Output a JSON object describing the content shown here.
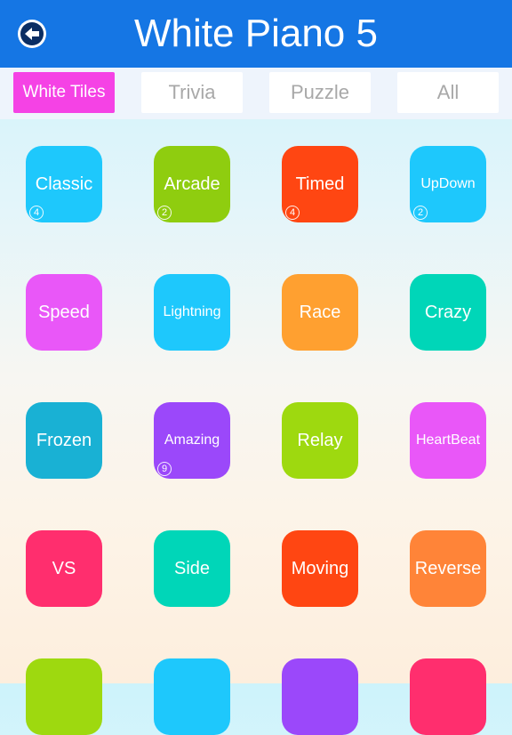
{
  "header": {
    "title": "White Piano 5",
    "back_icon": "back-arrow-circle-icon",
    "background": "#1576e4"
  },
  "tabs": [
    {
      "label": "White Tiles",
      "active": true
    },
    {
      "label": "Trivia",
      "active": false
    },
    {
      "label": "Puzzle",
      "active": false
    },
    {
      "label": "All",
      "active": false
    }
  ],
  "accent_color": "#f542e5",
  "modes": [
    {
      "label": "Classic",
      "color": "#1ec8fc",
      "badge": "4"
    },
    {
      "label": "Arcade",
      "color": "#8fcd0f",
      "badge": "2"
    },
    {
      "label": "Timed",
      "color": "#ff4612",
      "badge": "4"
    },
    {
      "label": "UpDown",
      "color": "#1ec8fc",
      "badge": "2",
      "small": true
    },
    {
      "label": "Speed",
      "color": "#e957f8"
    },
    {
      "label": "Lightning",
      "color": "#1ec8fc",
      "small": true
    },
    {
      "label": "Race",
      "color": "#ffa030"
    },
    {
      "label": "Crazy",
      "color": "#00d6b8"
    },
    {
      "label": "Frozen",
      "color": "#19b1d4"
    },
    {
      "label": "Amazing",
      "color": "#9b48fa",
      "badge": "9",
      "small": true
    },
    {
      "label": "Relay",
      "color": "#9ed90f"
    },
    {
      "label": "HeartBeat",
      "color": "#e957f8",
      "small": true
    },
    {
      "label": "VS",
      "color": "#ff2e6e"
    },
    {
      "label": "Side",
      "color": "#00d6b8"
    },
    {
      "label": "Moving",
      "color": "#ff4612"
    },
    {
      "label": "Reverse",
      "color": "#ff8438"
    },
    {
      "label": "",
      "color": "#9ed90f"
    },
    {
      "label": "",
      "color": "#1ec8fc"
    },
    {
      "label": "",
      "color": "#9b48fa"
    },
    {
      "label": "",
      "color": "#ff2e6e"
    }
  ]
}
